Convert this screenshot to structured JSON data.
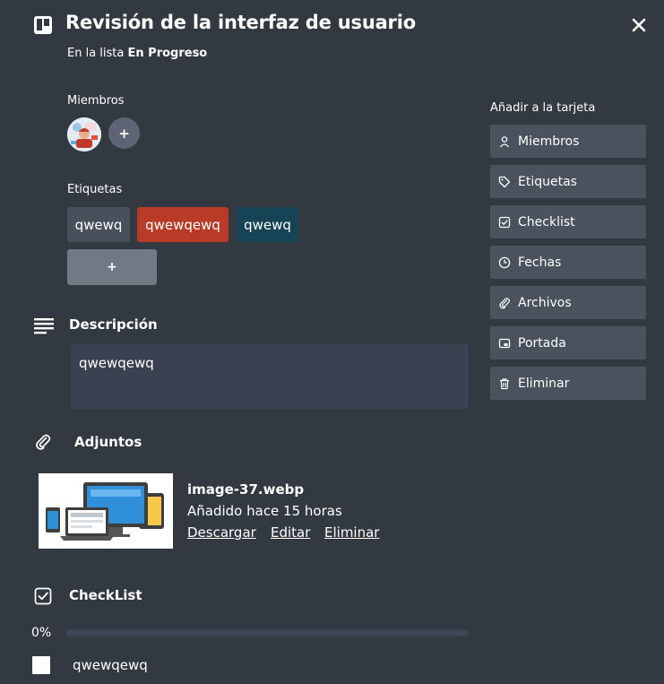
{
  "card": {
    "title": "Revisión de la interfaz de usuario",
    "list_prefix": "En la lista",
    "list_name": "En Progreso"
  },
  "members": {
    "label": "Miembros",
    "add_label": "+"
  },
  "labels": {
    "title": "Etiquetas",
    "items": [
      {
        "text": "qwewq",
        "color": "#47505b"
      },
      {
        "text": "qwewqewq",
        "color": "#b93a26"
      },
      {
        "text": "qwewq",
        "color": "#164454"
      }
    ],
    "add_label": "+"
  },
  "sidebar": {
    "title": "Añadir a la tarjeta",
    "buttons": [
      {
        "label": "Miembros",
        "icon": "user-icon"
      },
      {
        "label": "Etiquetas",
        "icon": "tag-icon"
      },
      {
        "label": "Checklist",
        "icon": "checkbox-icon"
      },
      {
        "label": "Fechas",
        "icon": "clock-icon"
      },
      {
        "label": "Archivos",
        "icon": "paperclip-icon"
      },
      {
        "label": "Portada",
        "icon": "cover-icon"
      },
      {
        "label": "Eliminar",
        "icon": "trash-icon"
      }
    ]
  },
  "description": {
    "title": "Descripción",
    "text": "qwewqewq"
  },
  "attachments": {
    "title": "Adjuntos",
    "items": [
      {
        "name": "image-37.webp",
        "added": "Añadido hace 15 horas",
        "actions": [
          "Descargar",
          "Editar",
          "Eliminar"
        ]
      }
    ]
  },
  "checklist": {
    "title": "CheckList",
    "progress_label": "0%",
    "progress": 0,
    "items": [
      {
        "text": "qwewqewq",
        "checked": false
      }
    ]
  },
  "colors": {
    "background": "#323940",
    "sidebar_button": "#4a525e",
    "description_box": "#3a4150",
    "progress_track": "#3e4555"
  }
}
